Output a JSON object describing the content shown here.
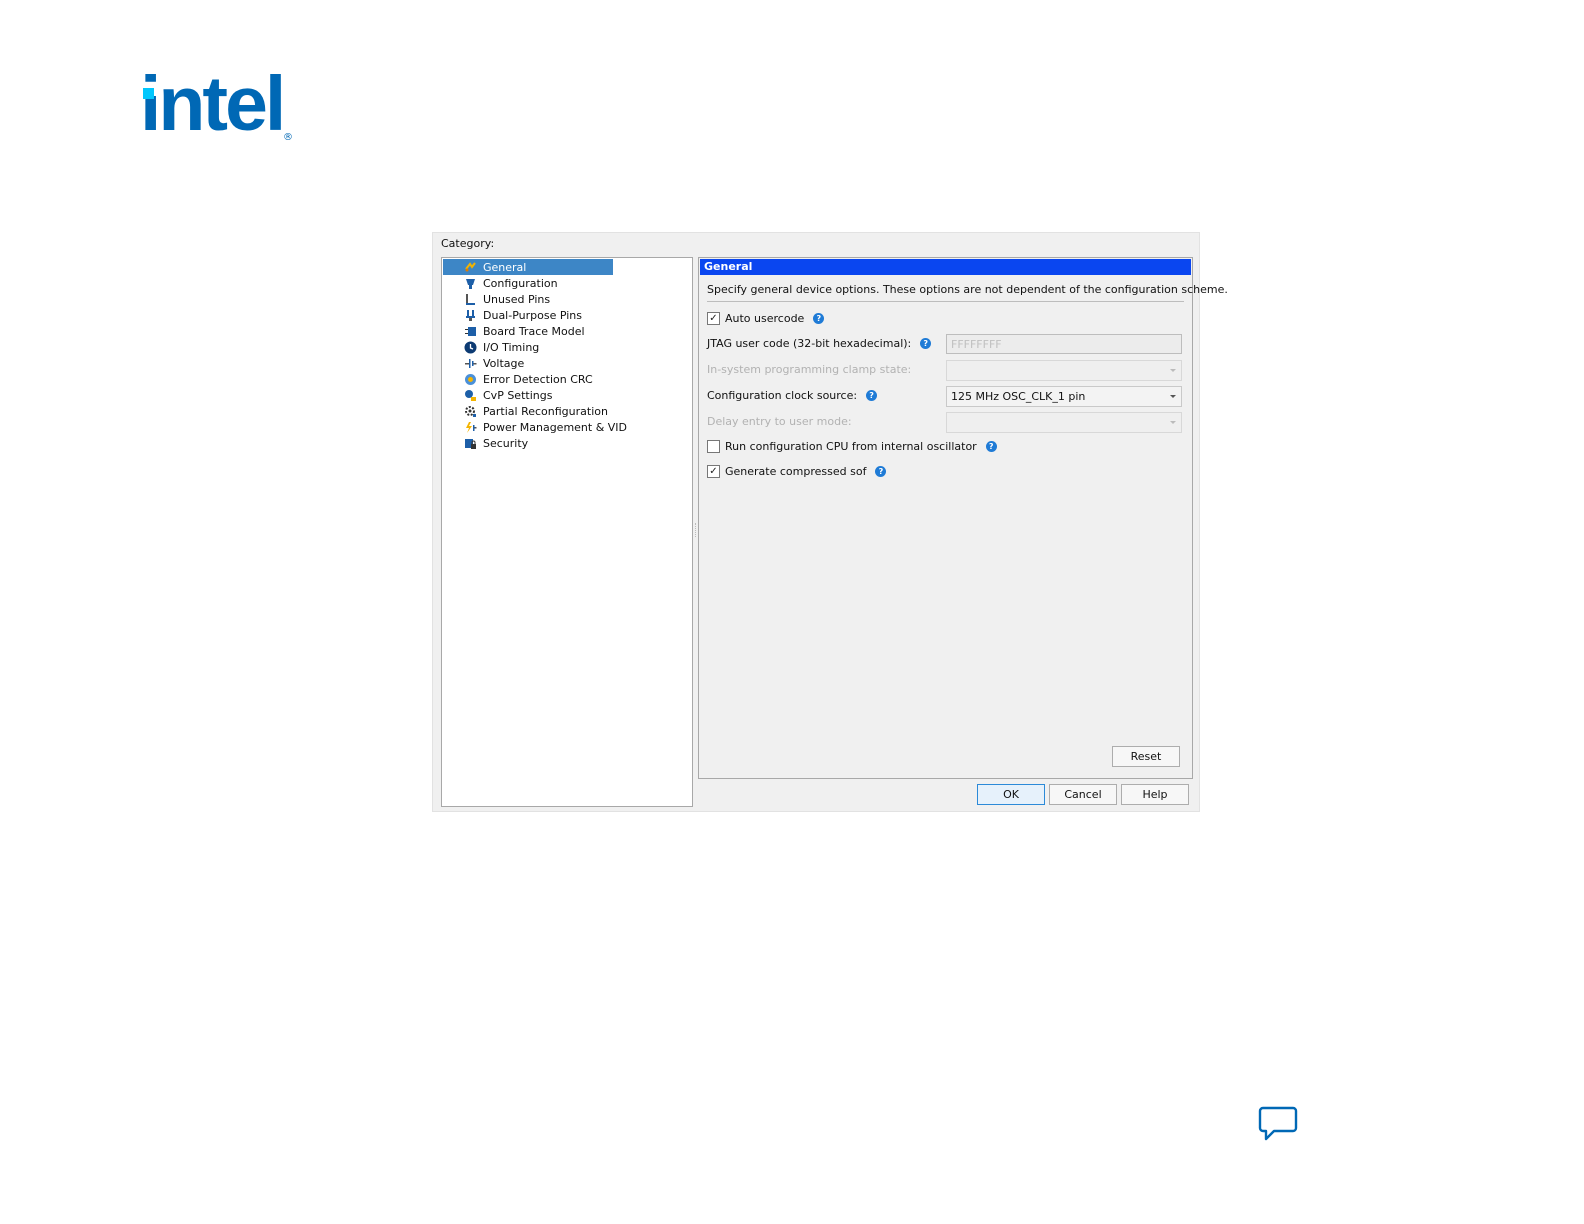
{
  "brand": {
    "logo_text": "intel",
    "logo_reg": "®",
    "logo_color": "#0068b5",
    "logo_dot_color": "#00c7fd"
  },
  "dialog": {
    "category_label": "Category:",
    "tree": [
      {
        "label": "General",
        "icon": "general-icon",
        "selected": true
      },
      {
        "label": "Configuration",
        "icon": "configuration-icon"
      },
      {
        "label": "Unused Pins",
        "icon": "unused-pins-icon"
      },
      {
        "label": "Dual-Purpose Pins",
        "icon": "dual-purpose-pins-icon"
      },
      {
        "label": "Board Trace Model",
        "icon": "board-trace-model-icon"
      },
      {
        "label": "I/O Timing",
        "icon": "io-timing-icon"
      },
      {
        "label": "Voltage",
        "icon": "voltage-icon"
      },
      {
        "label": "Error Detection CRC",
        "icon": "error-detection-crc-icon"
      },
      {
        "label": "CvP Settings",
        "icon": "cvp-settings-icon"
      },
      {
        "label": "Partial Reconfiguration",
        "icon": "partial-reconfiguration-icon"
      },
      {
        "label": "Power Management & VID",
        "icon": "power-management-icon"
      },
      {
        "label": "Security",
        "icon": "security-icon"
      }
    ],
    "panel": {
      "title": "General",
      "description": "Specify general device options. These options are not dependent of the configuration scheme.",
      "auto_usercode": {
        "label": "Auto usercode",
        "checked": true
      },
      "jtag_user_code": {
        "label": "JTAG user code (32-bit hexadecimal):",
        "value": "FFFFFFFF"
      },
      "clamp_state": {
        "label": "In-system programming clamp state:",
        "value": ""
      },
      "clock_source": {
        "label": "Configuration clock source:",
        "value": "125 MHz OSC_CLK_1 pin"
      },
      "delay_entry": {
        "label": "Delay entry to user mode:",
        "value": ""
      },
      "run_cpu_internal_osc": {
        "label": "Run configuration CPU from internal oscillator",
        "checked": false
      },
      "generate_compressed_sof": {
        "label": "Generate compressed sof",
        "checked": true
      },
      "reset_label": "Reset"
    },
    "buttons": {
      "ok": "OK",
      "cancel": "Cancel",
      "help": "Help"
    }
  },
  "colors": {
    "header_blue": "#0a46f0",
    "selection_blue": "#3d86c6",
    "help_blue": "#1f7bd6"
  }
}
